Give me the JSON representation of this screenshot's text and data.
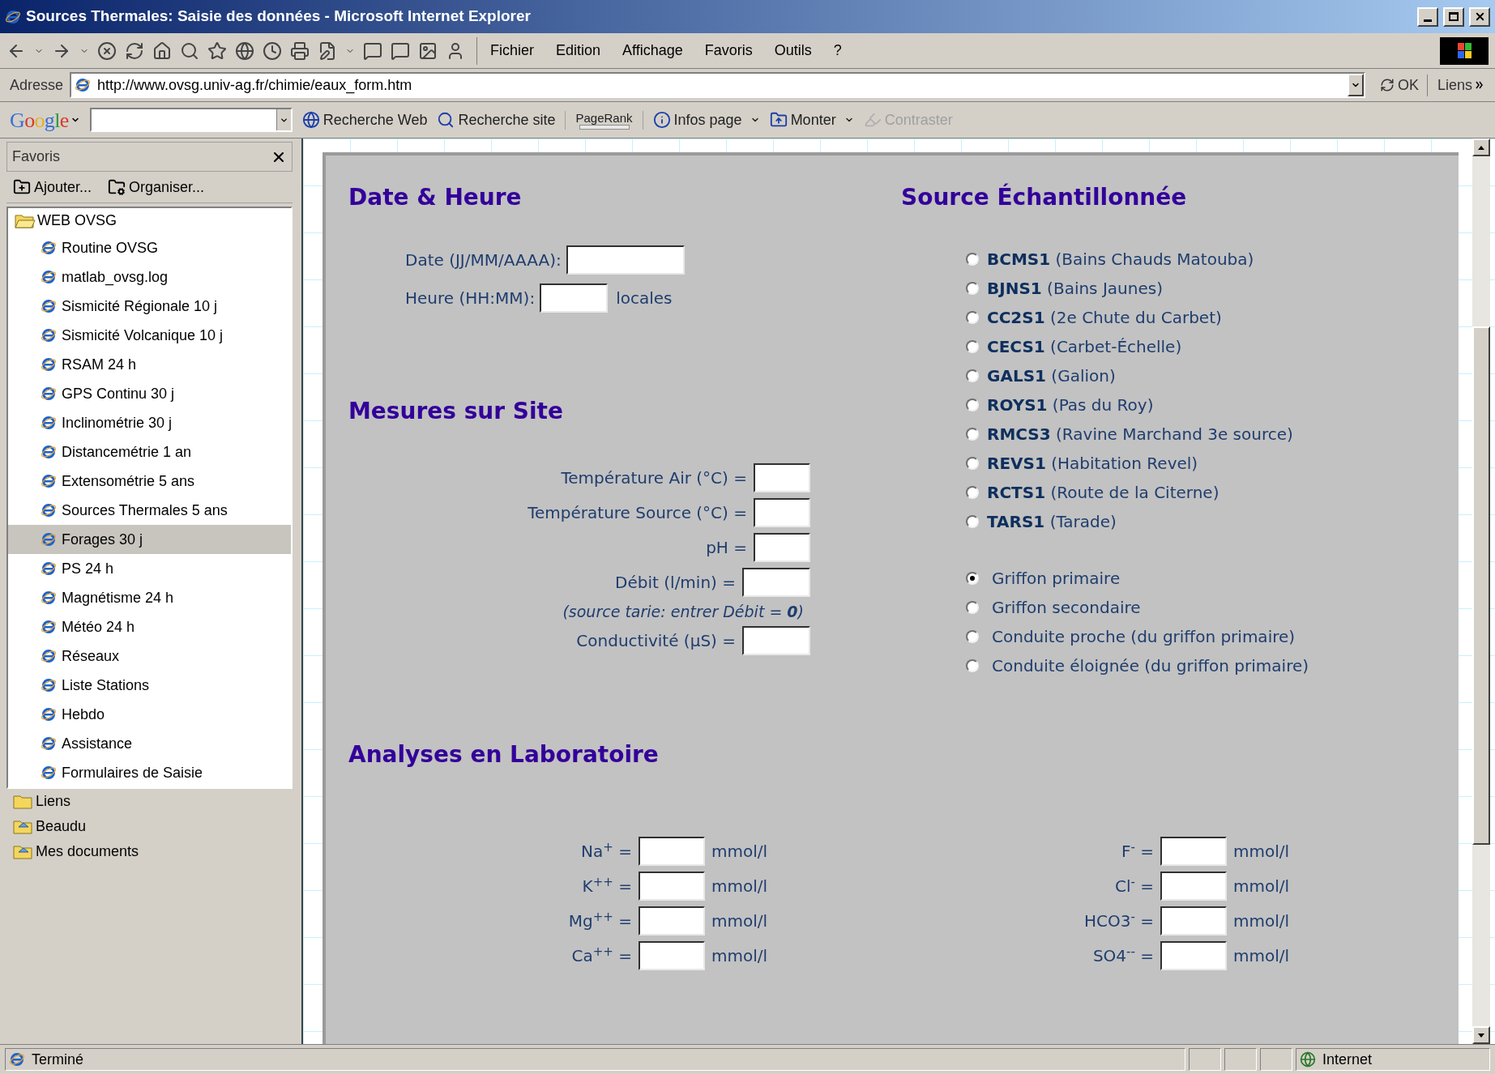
{
  "window": {
    "title": "Sources Thermales: Saisie des données - Microsoft Internet Explorer"
  },
  "menu": [
    "Fichier",
    "Edition",
    "Affichage",
    "Favoris",
    "Outils",
    "?"
  ],
  "address_bar": {
    "label": "Adresse",
    "url": "http://www.ovsg.univ-ag.fr/chimie/eaux_form.htm",
    "go": "OK",
    "links": "Liens"
  },
  "google_toolbar": {
    "logo": "Google",
    "items": [
      {
        "kind": "web",
        "label": "Recherche Web",
        "disabled": false,
        "dropdown": false
      },
      {
        "kind": "site",
        "label": "Recherche site",
        "disabled": false,
        "dropdown": false
      },
      {
        "kind": "pagerank",
        "label": "PageRank",
        "disabled": false,
        "dropdown": false
      },
      {
        "kind": "info",
        "label": "Infos page",
        "disabled": false,
        "dropdown": true
      },
      {
        "kind": "up",
        "label": "Monter",
        "disabled": false,
        "dropdown": true
      },
      {
        "kind": "highlight",
        "label": "Contraster",
        "disabled": true,
        "dropdown": false
      }
    ]
  },
  "sidebar": {
    "title": "Favoris",
    "buttons": [
      "Ajouter...",
      "Organiser..."
    ],
    "items": [
      {
        "label": "WEB OVSG",
        "kind": "folder",
        "expanded": true,
        "children": [
          {
            "label": "Routine OVSG",
            "selected": false
          },
          {
            "label": "matlab_ovsg.log",
            "selected": false
          },
          {
            "label": "Sismicité Régionale 10 j",
            "selected": false
          },
          {
            "label": "Sismicité Volcanique 10 j",
            "selected": false
          },
          {
            "label": "RSAM 24 h",
            "selected": false
          },
          {
            "label": "GPS Continu 30 j",
            "selected": false
          },
          {
            "label": "Inclinométrie 30 j",
            "selected": false
          },
          {
            "label": "Distancemétrie 1 an",
            "selected": false
          },
          {
            "label": "Extensométrie 5 ans",
            "selected": false
          },
          {
            "label": "Sources Thermales 5 ans",
            "selected": false
          },
          {
            "label": "Forages 30 j",
            "selected": true
          },
          {
            "label": "PS 24 h",
            "selected": false
          },
          {
            "label": "Magnétisme 24 h",
            "selected": false
          },
          {
            "label": "Météo 24 h",
            "selected": false
          },
          {
            "label": "Réseaux",
            "selected": false
          },
          {
            "label": "Liste Stations",
            "selected": false
          },
          {
            "label": "Hebdo",
            "selected": false
          },
          {
            "label": "Assistance",
            "selected": false
          },
          {
            "label": "Formulaires de Saisie",
            "selected": false
          }
        ]
      },
      {
        "label": "Liens",
        "kind": "folder",
        "expanded": false
      },
      {
        "label": "Beaudu",
        "kind": "shared",
        "expanded": false
      },
      {
        "label": "Mes documents",
        "kind": "shared",
        "expanded": false
      }
    ]
  },
  "date_heure": {
    "heading": "Date & Heure",
    "date_label": "Date (JJ/MM/AAAA):",
    "time_label": "Heure (HH:MM):",
    "time_suffix": "locales"
  },
  "mesures": {
    "heading": "Mesures sur Site",
    "rows": [
      {
        "kind": "field",
        "label": "Température Air (°C) ="
      },
      {
        "kind": "field",
        "label": "Température Source (°C) ="
      },
      {
        "kind": "field",
        "label": "pH ="
      },
      {
        "kind": "wide",
        "label": "Débit (l/min) ="
      },
      {
        "kind": "note",
        "label": "(source tarie: entrer Débit = **0**)"
      },
      {
        "kind": "wide",
        "label": "Conductivité (µS) ="
      }
    ]
  },
  "source": {
    "heading": "Source Échantillonnée",
    "stations": [
      {
        "code": "BCMS1",
        "name": "(Bains Chauds Matouba)",
        "selected": false
      },
      {
        "code": "BJNS1",
        "name": "(Bains Jaunes)",
        "selected": false
      },
      {
        "code": "CC2S1",
        "name": "(2e Chute du Carbet)",
        "selected": false
      },
      {
        "code": "CECS1",
        "name": "(Carbet-Échelle)",
        "selected": false
      },
      {
        "code": "GALS1",
        "name": "(Galion)",
        "selected": false
      },
      {
        "code": "ROYS1",
        "name": "(Pas du Roy)",
        "selected": false
      },
      {
        "code": "RMCS3",
        "name": "(Ravine Marchand 3e source)",
        "selected": false
      },
      {
        "code": "REVS1",
        "name": "(Habitation Revel)",
        "selected": false
      },
      {
        "code": "RCTS1",
        "name": "(Route de la Citerne)",
        "selected": false
      },
      {
        "code": "TARS1",
        "name": "(Tarade)",
        "selected": false
      }
    ],
    "positions": [
      {
        "label": "Griffon primaire",
        "selected": true
      },
      {
        "label": "Griffon secondaire",
        "selected": false
      },
      {
        "label": "Conduite proche (du griffon primaire)",
        "selected": false
      },
      {
        "label": "Conduite éloignée (du griffon primaire)",
        "selected": false
      }
    ]
  },
  "analyses": {
    "heading": "Analyses en Laboratoire",
    "cations": [
      {
        "label": "Na$^{+}$ =",
        "unit": "mmol/l"
      },
      {
        "label": "K$^{++}$ =",
        "unit": "mmol/l"
      },
      {
        "label": "Mg$^{++}$ =",
        "unit": "mmol/l"
      },
      {
        "label": "Ca$^{++}$ =",
        "unit": "mmol/l"
      }
    ],
    "anions": [
      {
        "label": "F$^{-}$ =",
        "unit": "mmol/l"
      },
      {
        "label": "Cl$^{-}$ =",
        "unit": "mmol/l"
      },
      {
        "label": "HCO3$^{-}$ =",
        "unit": "mmol/l"
      },
      {
        "label": "SO4$^{--}$ =",
        "unit": "mmol/l"
      }
    ]
  },
  "status_bar": {
    "text": "Terminé",
    "zone": "Internet"
  }
}
